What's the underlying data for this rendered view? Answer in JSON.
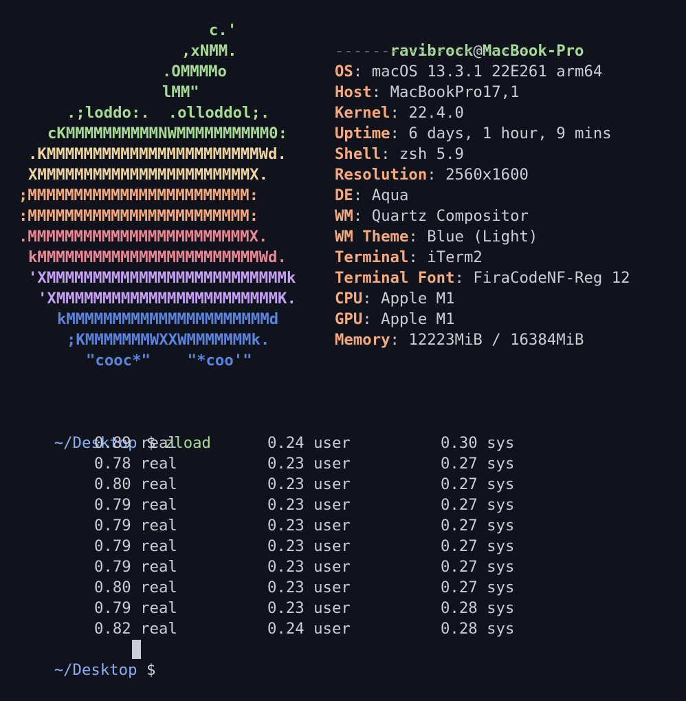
{
  "colors": {
    "background": "#10131b",
    "green": "#a6da95",
    "yellow": "#eed49f",
    "orange": "#f5a97f",
    "red": "#ed8796",
    "purple": "#c6a0f6",
    "blue": "#5b84e0",
    "prompt_path": "#8aadf4"
  },
  "logo": [
    "c.'",
    ",xNMM.",
    ".OMMMMo",
    "lMM\"",
    ".;loddo:.  .olloddol;.",
    "cKMMMMMMMMMMNWMMMMMMMMMM0:",
    ".KMMMMMMMMMMMMMMMMMMMMMMMWd.",
    "XMMMMMMMMMMMMMMMMMMMMMMMX.",
    ";MMMMMMMMMMMMMMMMMMMMMMMM:",
    ":MMMMMMMMMMMMMMMMMMMMMMMM:",
    ".MMMMMMMMMMMMMMMMMMMMMMMMX.",
    "kMMMMMMMMMMMMMMMMMMMMMMMMWd.",
    "'XMMMMMMMMMMMMMMMMMMMMMMMMMMk",
    "'XMMMMMMMMMMMMMMMMMMMMMMMMK.",
    "kMMMMMMMMMMMMMMMMMMMMMMd",
    ";KMMMMMMMWXXWMMMMMMMk.",
    "\"cooc*\"    \"*coo'\""
  ],
  "neofetch": {
    "user": "ravibrock",
    "at": "@",
    "host": "MacBook-Pro",
    "separator": "---------------------",
    "items": [
      {
        "key": "OS",
        "value": "macOS 13.3.1 22E261 arm64"
      },
      {
        "key": "Host",
        "value": "MacBookPro17,1"
      },
      {
        "key": "Kernel",
        "value": "22.4.0"
      },
      {
        "key": "Uptime",
        "value": "6 days, 1 hour, 9 mins"
      },
      {
        "key": "Shell",
        "value": "zsh 5.9"
      },
      {
        "key": "Resolution",
        "value": "2560x1600"
      },
      {
        "key": "DE",
        "value": "Aqua"
      },
      {
        "key": "WM",
        "value": "Quartz Compositor"
      },
      {
        "key": "WM Theme",
        "value": "Blue (Light)"
      },
      {
        "key": "Terminal",
        "value": "iTerm2"
      },
      {
        "key": "Terminal Font",
        "value": "FiraCodeNF-Reg 12"
      },
      {
        "key": "CPU",
        "value": "Apple M1"
      },
      {
        "key": "GPU",
        "value": "Apple M1"
      },
      {
        "key": "Memory",
        "value": "12223MiB / 16384MiB"
      }
    ]
  },
  "session": {
    "prompt_path": "~/Desktop",
    "prompt_symbol": "$",
    "command": "zload",
    "results": [
      {
        "real": "0.89 real",
        "user": "0.24 user",
        "sys": "0.30 sys"
      },
      {
        "real": "0.78 real",
        "user": "0.23 user",
        "sys": "0.27 sys"
      },
      {
        "real": "0.80 real",
        "user": "0.23 user",
        "sys": "0.27 sys"
      },
      {
        "real": "0.79 real",
        "user": "0.23 user",
        "sys": "0.27 sys"
      },
      {
        "real": "0.79 real",
        "user": "0.23 user",
        "sys": "0.27 sys"
      },
      {
        "real": "0.79 real",
        "user": "0.23 user",
        "sys": "0.27 sys"
      },
      {
        "real": "0.79 real",
        "user": "0.23 user",
        "sys": "0.27 sys"
      },
      {
        "real": "0.80 real",
        "user": "0.23 user",
        "sys": "0.27 sys"
      },
      {
        "real": "0.79 real",
        "user": "0.23 user",
        "sys": "0.28 sys"
      },
      {
        "real": "0.82 real",
        "user": "0.24 user",
        "sys": "0.28 sys"
      }
    ]
  }
}
